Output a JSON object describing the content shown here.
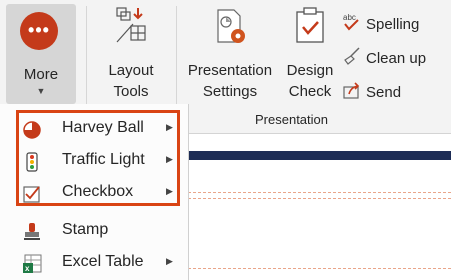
{
  "ribbon": {
    "more_label": "More",
    "layout_tools": {
      "line1": "Layout",
      "line2": "Tools"
    },
    "presentation_settings": {
      "line1": "Presentation",
      "line2": "Settings"
    },
    "design_check": {
      "line1": "Design",
      "line2": "Check"
    },
    "spelling_label": "Spelling",
    "clean_up_label": "Clean up",
    "send_label": "Send",
    "group_label": "Presentation"
  },
  "menu": {
    "items": [
      {
        "label": "Harvey Ball",
        "icon": "harvey-ball-icon",
        "has_submenu": true
      },
      {
        "label": "Traffic Light",
        "icon": "traffic-light-icon",
        "has_submenu": true
      },
      {
        "label": "Checkbox",
        "icon": "checkbox-icon",
        "has_submenu": true
      },
      {
        "label": "Stamp",
        "icon": "stamp-icon",
        "has_submenu": false
      },
      {
        "label": "Excel Table",
        "icon": "excel-table-icon",
        "has_submenu": true
      }
    ]
  },
  "colors": {
    "accent": "#c43a1a",
    "highlight_border": "#d94414",
    "slide_band": "#1d2c55",
    "ribbon_bg": "#f3f3f3"
  }
}
